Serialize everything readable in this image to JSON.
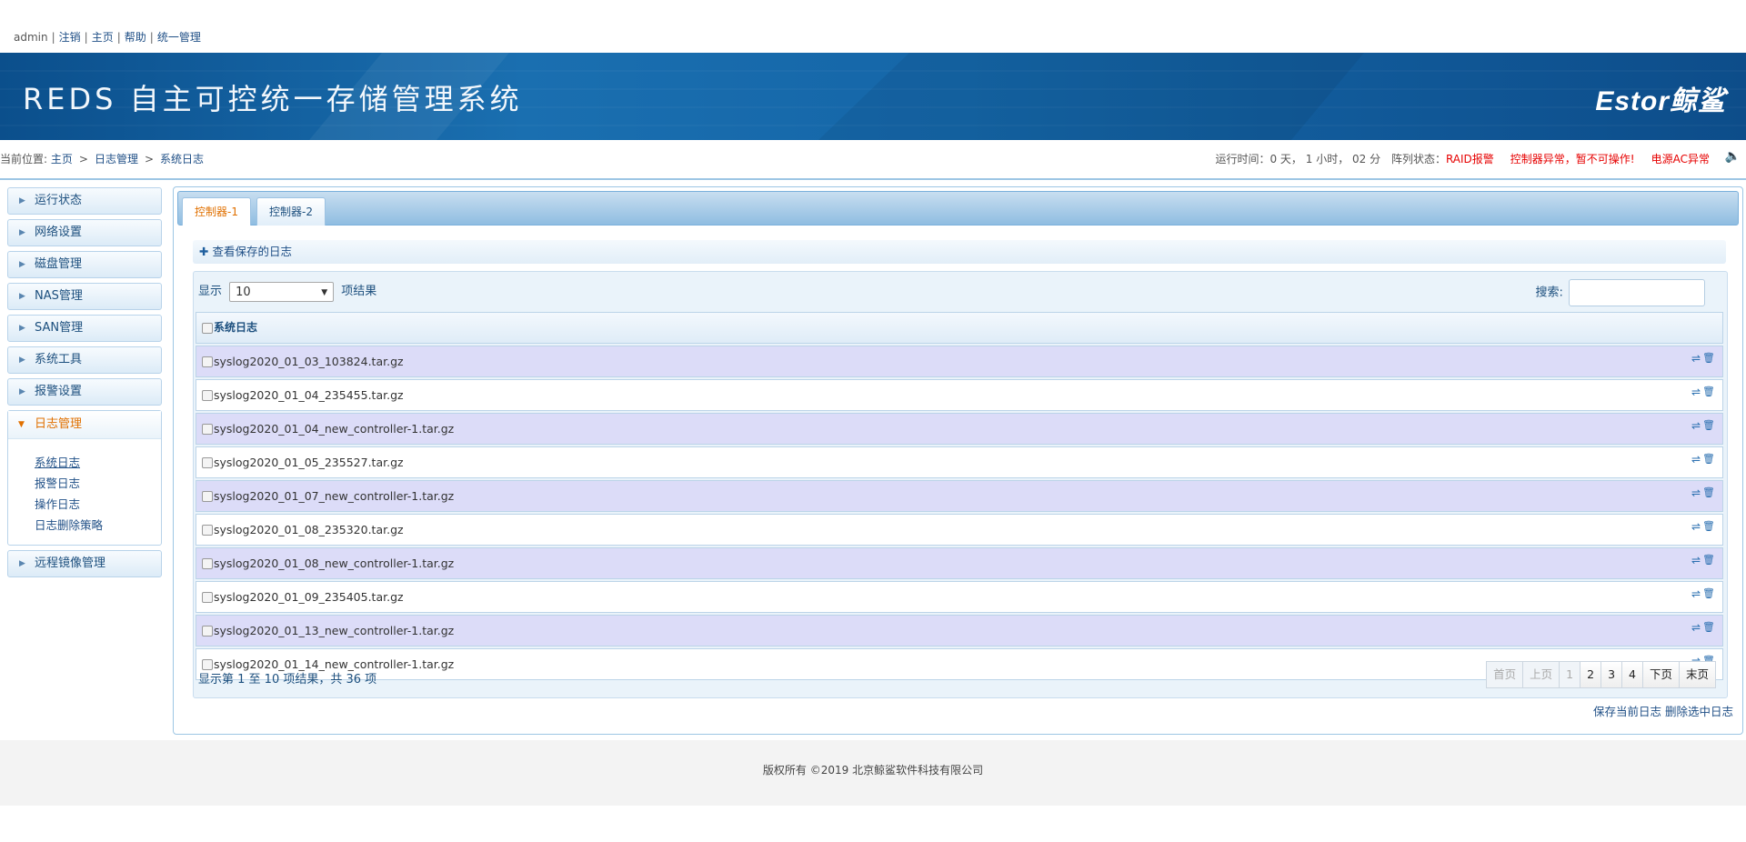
{
  "top_links": {
    "user": "admin",
    "logout": "注销",
    "home": "主页",
    "help": "帮助",
    "unified": "统一管理"
  },
  "banner": {
    "title": "REDS 自主可控统一存储管理系统",
    "logo": "Estor鲸鲨"
  },
  "location": {
    "prefix": "当前位置:",
    "home": "主页",
    "section": "日志管理",
    "page": "系统日志"
  },
  "status": {
    "runtime": "运行时间：0 天， 1 小时， 02 分",
    "array_label": "阵列状态：",
    "raid_alarm": "RAID报警",
    "controller_alarm": "控制器异常，暂不可操作!",
    "power_alarm": "电源AC异常"
  },
  "sidebar": {
    "items": [
      {
        "label": "运行状态"
      },
      {
        "label": "网络设置"
      },
      {
        "label": "磁盘管理"
      },
      {
        "label": "NAS管理"
      },
      {
        "label": "SAN管理"
      },
      {
        "label": "系统工具"
      },
      {
        "label": "报警设置"
      }
    ],
    "open": {
      "label": "日志管理",
      "sub": [
        "系统日志",
        "报警日志",
        "操作日志",
        "日志删除策略"
      ]
    },
    "after": [
      {
        "label": "远程镜像管理"
      }
    ]
  },
  "tabs": [
    "控制器-1",
    "控制器-2"
  ],
  "saved_logs": "查看保存的日志",
  "table": {
    "show_label": "显示",
    "page_size": "10",
    "results_label": "项结果",
    "search_label": "搜索:",
    "header": "系统日志",
    "rows": [
      "syslog2020_01_03_103824.tar.gz",
      "syslog2020_01_04_235455.tar.gz",
      "syslog2020_01_04_new_controller-1.tar.gz",
      "syslog2020_01_05_235527.tar.gz",
      "syslog2020_01_07_new_controller-1.tar.gz",
      "syslog2020_01_08_235320.tar.gz",
      "syslog2020_01_08_new_controller-1.tar.gz",
      "syslog2020_01_09_235405.tar.gz",
      "syslog2020_01_13_new_controller-1.tar.gz",
      "syslog2020_01_14_new_controller-1.tar.gz"
    ],
    "info": "显示第 1 至 10 项结果，共 36 项",
    "pager": {
      "first": "首页",
      "prev": "上页",
      "pages": [
        "1",
        "2",
        "3",
        "4"
      ],
      "next": "下页",
      "last": "末页"
    }
  },
  "actions": {
    "save": "保存当前日志",
    "delete": "删除选中日志"
  },
  "footer": "版权所有 ©2019 北京鲸鲨软件科技有限公司",
  "icons": {
    "download": "download-icon",
    "delete": "trash-icon"
  }
}
